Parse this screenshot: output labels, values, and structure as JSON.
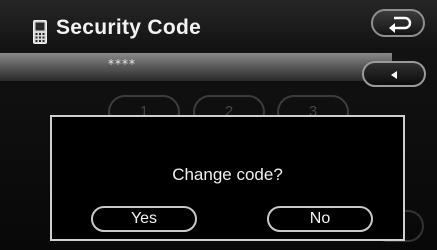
{
  "header": {
    "title": "Security Code",
    "icon": "phone-icon",
    "back_icon": "return-arrow-icon"
  },
  "entry": {
    "value": "****",
    "delete_icon": "left-triangle-icon"
  },
  "keypad": {
    "keys": [
      "1",
      "2",
      "3"
    ]
  },
  "dialog": {
    "message": "Change code?",
    "yes_label": "Yes",
    "no_label": "No"
  }
}
